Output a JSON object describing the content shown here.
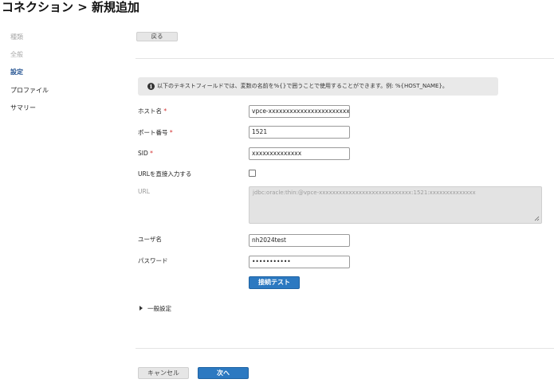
{
  "page": {
    "title": "コネクション > 新規追加"
  },
  "sidebar": {
    "items": [
      {
        "label": "種類"
      },
      {
        "label": "全般"
      },
      {
        "label": "設定"
      },
      {
        "label": "プロファイル"
      },
      {
        "label": "サマリー"
      }
    ]
  },
  "toolbar": {
    "back_label": "戻る"
  },
  "info": {
    "icon": "info-icon",
    "text": "以下のテキストフィールドでは、変数の名前を%{}で囲うことで使用することができます。例: %{HOST_NAME}。"
  },
  "form": {
    "host": {
      "label": "ホスト名",
      "required_mark": "*",
      "value": "vpce-xxxxxxxxxxxxxxxxxxxxxxxxxxxx"
    },
    "port": {
      "label": "ポート番号",
      "required_mark": "*",
      "value": "1521"
    },
    "sid": {
      "label": "SID",
      "required_mark": "*",
      "value": "xxxxxxxxxxxxxx"
    },
    "url_direct": {
      "label": "URLを直接入力する",
      "checked": false
    },
    "url": {
      "label": "URL",
      "value": "jdbc:oracle:thin:@vpce-xxxxxxxxxxxxxxxxxxxxxxxxxxxx:1521:xxxxxxxxxxxxxx"
    },
    "username": {
      "label": "ユーザ名",
      "value": "nh2024test"
    },
    "password": {
      "label": "パスワード",
      "value": "•••••••••••"
    },
    "test_button": "接続テスト",
    "advanced": {
      "label": "一般設定",
      "icon": "caret-right-icon"
    }
  },
  "footer": {
    "cancel_label": "キャンセル",
    "next_label": "次へ"
  }
}
